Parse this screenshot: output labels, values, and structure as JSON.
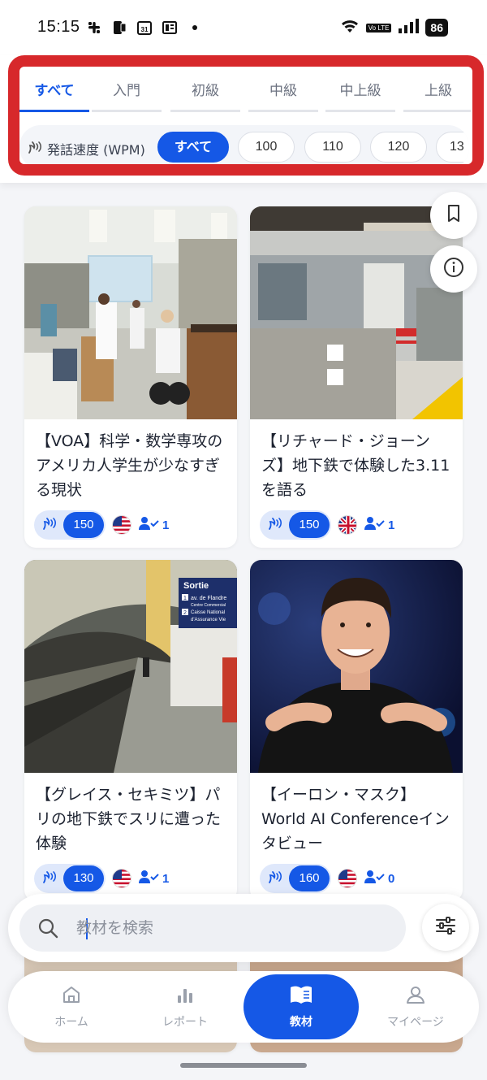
{
  "status": {
    "time": "15:15",
    "battery": "86",
    "volte": "Vo LTE",
    "calendar_day": "31"
  },
  "tabs": [
    {
      "label": "すべて",
      "active": true
    },
    {
      "label": "入門",
      "active": false
    },
    {
      "label": "初級",
      "active": false
    },
    {
      "label": "中級",
      "active": false
    },
    {
      "label": "中上級",
      "active": false
    },
    {
      "label": "上級",
      "active": false
    }
  ],
  "speed": {
    "label": "発話速度 (WPM)",
    "options": [
      {
        "label": "すべて",
        "active": true
      },
      {
        "label": "100",
        "active": false
      },
      {
        "label": "110",
        "active": false
      },
      {
        "label": "120",
        "active": false
      },
      {
        "label": "13",
        "active": false
      }
    ]
  },
  "cards": [
    {
      "title": "【VOA】科学・数学専攻のアメリカ人学生が少なすぎる現状",
      "wpm": "150",
      "flag": "us-flag",
      "learners": "1",
      "image": "laboratory-photo"
    },
    {
      "title": "【リチャード・ジョーンズ】地下鉄で体験した3.11を語る",
      "wpm": "150",
      "flag": "uk-flag",
      "learners": "1",
      "image": "subway-train-photo"
    },
    {
      "title": "【グレイス・セキミツ】パリの地下鉄でスリに遭った体験",
      "wpm": "130",
      "flag": "us-flag",
      "learners": "1",
      "image": "paris-metro-photo"
    },
    {
      "title": "【イーロン・マスク】World AI Conferenceインタビュー",
      "wpm": "160",
      "flag": "us-flag",
      "learners": "0",
      "image": "portrait-photo"
    }
  ],
  "photo_text": {
    "sign_title": "Sortie",
    "sign_line1": "av. de Flandre",
    "sign_line2": "Centre Commercial",
    "sign_line3": "Caisse National",
    "sign_line4": "d'Assurance Vie",
    "sign_num1": "1",
    "sign_num2": "2"
  },
  "search": {
    "placeholder": "教材を検索"
  },
  "nav": [
    {
      "label": "ホーム",
      "icon": "home-icon",
      "active": false
    },
    {
      "label": "レポート",
      "icon": "chart-icon",
      "active": false
    },
    {
      "label": "教材",
      "icon": "book-icon",
      "active": true
    },
    {
      "label": "マイページ",
      "icon": "person-icon",
      "active": false
    }
  ],
  "colors": {
    "accent": "#1558e6",
    "highlight_frame": "#d7282b"
  }
}
